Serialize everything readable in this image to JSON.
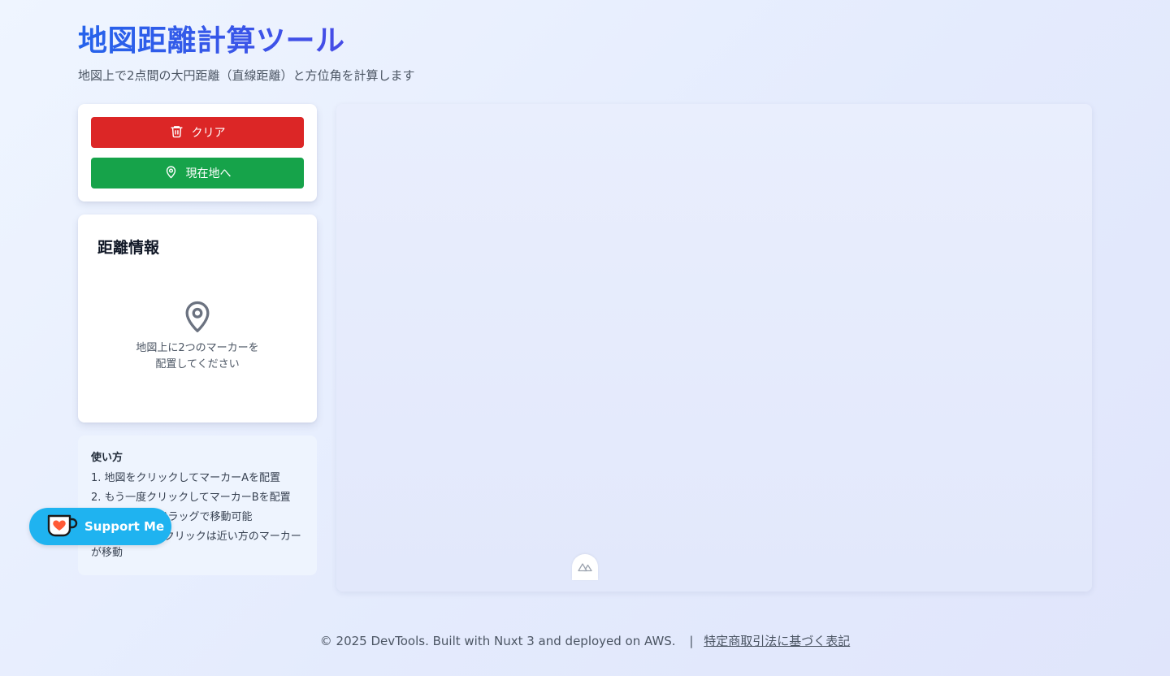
{
  "header": {
    "title": "地図距離計算ツール",
    "subtitle": "地図上で2点間の大円距離（直線距離）と方位角を計算します"
  },
  "controls": {
    "clear_label": "クリア",
    "current_location_label": "現在地へ",
    "clear_icon": "trash-icon",
    "location_icon": "map-pin-icon"
  },
  "distance_info": {
    "title": "距離情報",
    "empty_icon": "map-pin-icon",
    "empty_message": "地図上に2つのマーカーを\n配置してください"
  },
  "usage": {
    "title": "使い方",
    "steps": [
      "1. 地図をクリックしてマーカーAを配置",
      "2. もう一度クリックしてマーカーBを配置",
      "3. マーカーはドラッグで移動可能",
      "4. 3回目以降のクリックは近い方のマーカーが移動"
    ]
  },
  "map": {
    "badge_icon": "nuxt-icon"
  },
  "support": {
    "label": "Support Me",
    "icon": "coffee-cup-heart-icon"
  },
  "footer": {
    "copyright": "© 2025 DevTools. Built with Nuxt 3 and deployed on AWS.",
    "separator": "|",
    "legal_link": "特定商取引法に基づく表記"
  },
  "colors": {
    "title_gradient_start": "#2563eb",
    "title_gradient_end": "#4f46e5",
    "clear_button": "#dc2626",
    "location_button": "#16a34a",
    "support_button": "#1fb3f0",
    "coffee_heart": "#ff5a36"
  }
}
